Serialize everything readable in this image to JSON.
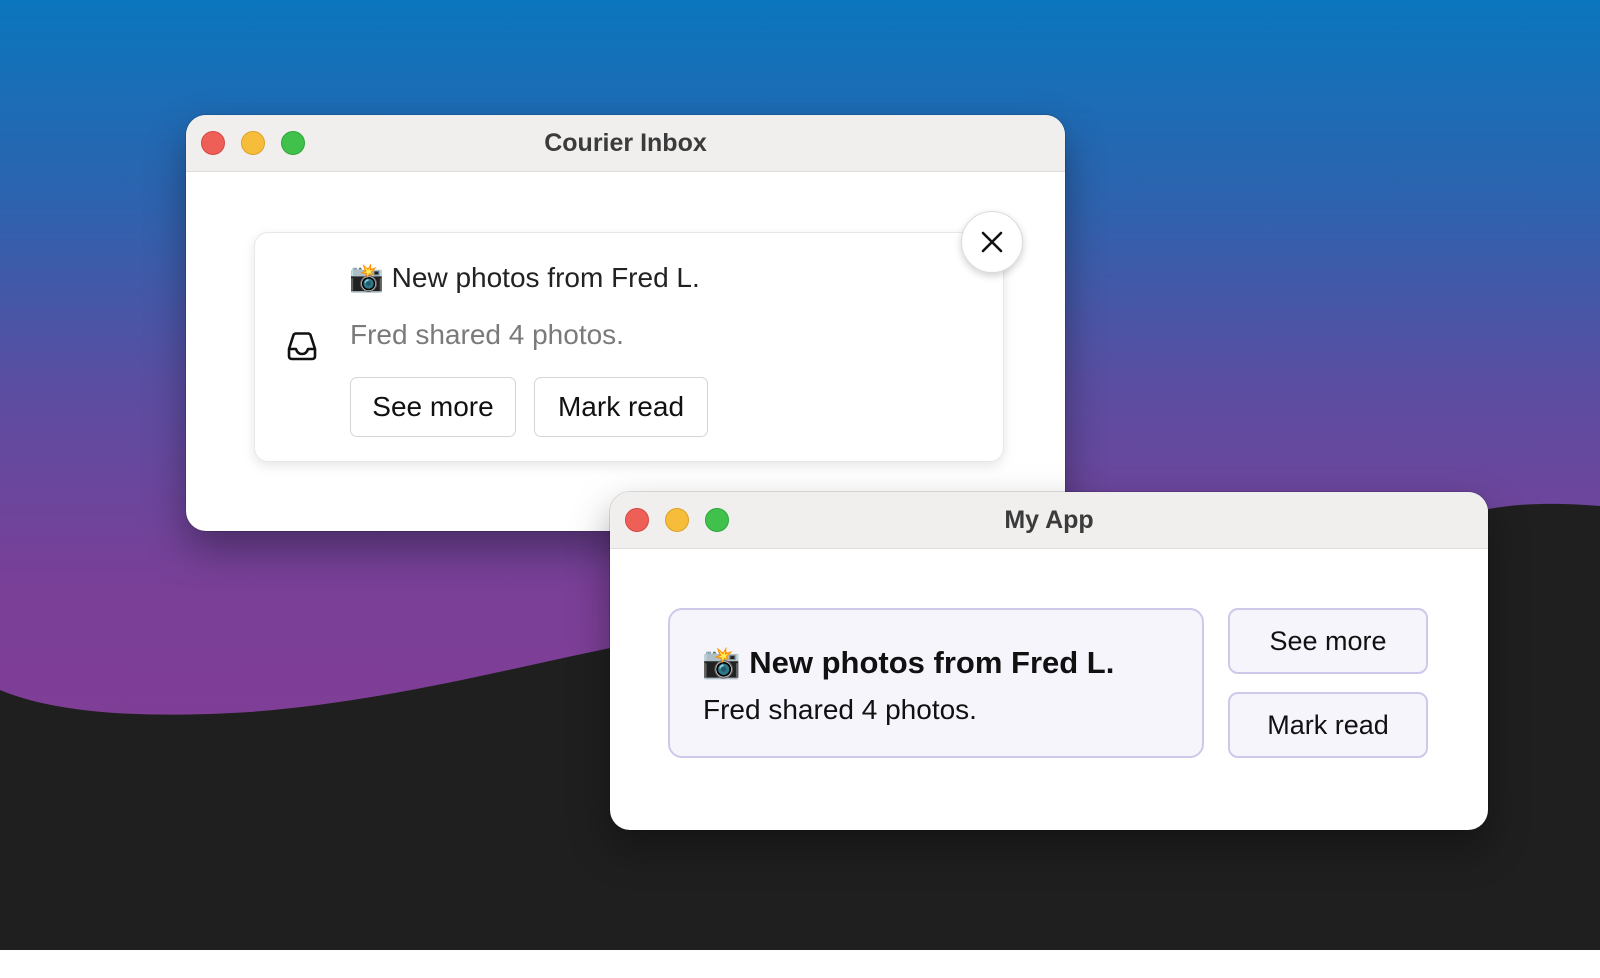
{
  "colors": {
    "accent_purple_border": "#cec8ea",
    "card_tint": "#f6f5fc",
    "traffic_red": "#ee5f58",
    "traffic_yellow": "#f6bd3a",
    "traffic_green": "#3fc14b"
  },
  "inbox_window": {
    "title": "Courier Inbox",
    "message": {
      "icon": "inbox-tray-icon",
      "emoji": "📸",
      "title": "New photos from Fred L.",
      "body": "Fred shared 4 photos.",
      "actions": [
        "See more",
        "Mark read"
      ]
    },
    "close_icon": "close-icon"
  },
  "app_window": {
    "title": "My App",
    "message": {
      "emoji": "📸",
      "title": "New photos from Fred L.",
      "body": "Fred shared 4 photos."
    },
    "actions": [
      "See more",
      "Mark read"
    ]
  }
}
